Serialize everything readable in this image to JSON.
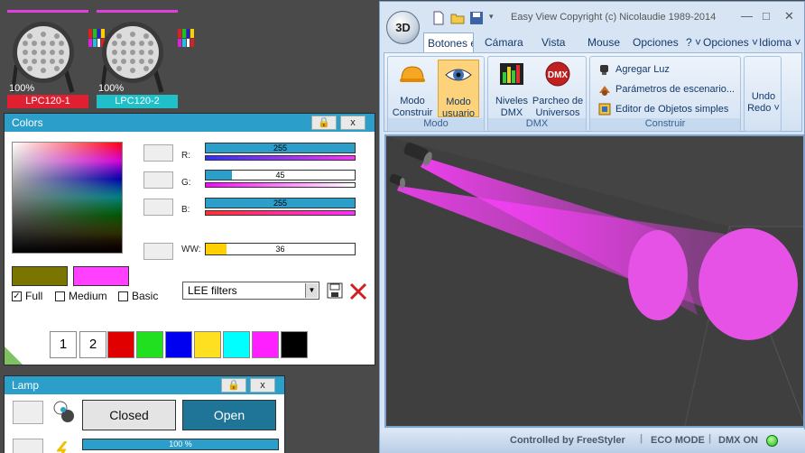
{
  "fixtures": [
    {
      "percent": "100%",
      "name": "LPC120-1",
      "name_color": "#e02030"
    },
    {
      "percent": "100%",
      "name": "LPC120-2",
      "name_color": "#20c0c8"
    }
  ],
  "colors_panel": {
    "title": "Colors",
    "lock_icon": "lock-icon",
    "close_label": "x",
    "channels": [
      {
        "label": "R:",
        "value": "255",
        "fraction": 1.0
      },
      {
        "label": "G:",
        "value": "45",
        "fraction": 0.176
      },
      {
        "label": "B:",
        "value": "255",
        "fraction": 1.0
      }
    ],
    "ww": {
      "label": "WW:",
      "value": "36",
      "fraction": 0.141
    },
    "swatch_a_color": "#7a7400",
    "swatch_b_color": "#ff40ff",
    "checks": [
      {
        "label": "Full",
        "checked": true
      },
      {
        "label": "Medium",
        "checked": false
      },
      {
        "label": "Basic",
        "checked": false
      }
    ],
    "filter_select": "LEE filters",
    "palette_numbers": [
      "1",
      "2"
    ],
    "palette_colors": [
      "#e00000",
      "#20e020",
      "#0000f0",
      "#ffe020",
      "#00ffff",
      "#ff20ff",
      "#000000"
    ]
  },
  "lamp_panel": {
    "title": "Lamp",
    "close_label": "x",
    "closed_label": "Closed",
    "open_label": "Open",
    "dimmer_value": "100 %"
  },
  "window": {
    "title": "Easy View   Copyright (c) Nicolaudie 1989-2014",
    "orb_label": "3D",
    "tabs": [
      "Botones e",
      "Cámara",
      "Vista",
      "Mouse",
      "Opciones"
    ],
    "right_menus": [
      "? ˅",
      "Opciones ˅",
      "Idioma ˅"
    ],
    "groups": {
      "modo": {
        "label": "Modo",
        "buttons": [
          {
            "line1": "Modo",
            "line2": "Construir",
            "icon": "hardhat-icon"
          },
          {
            "line1": "Modo",
            "line2": "usuario",
            "icon": "eye-icon"
          }
        ]
      },
      "dmx": {
        "label": "DMX",
        "buttons": [
          {
            "line1": "Niveles",
            "line2": "DMX",
            "icon": "levels-icon"
          },
          {
            "line1": "Parcheo de",
            "line2": "Universos",
            "icon": "dmx-icon"
          }
        ]
      },
      "construir": {
        "label": "Construir",
        "items": [
          {
            "label": "Agregar Luz",
            "icon": "spotlight-icon"
          },
          {
            "label": "Parámetros de escenario...",
            "icon": "scene-icon"
          },
          {
            "label": "Editor de Objetos simples",
            "icon": "objects-icon"
          }
        ]
      },
      "undo": {
        "line1": "Undo",
        "line2": "Redo ˅"
      }
    },
    "status": {
      "controlled": "Controlled by FreeStyler",
      "eco": "ECO MODE",
      "dmx": "DMX ON"
    }
  }
}
